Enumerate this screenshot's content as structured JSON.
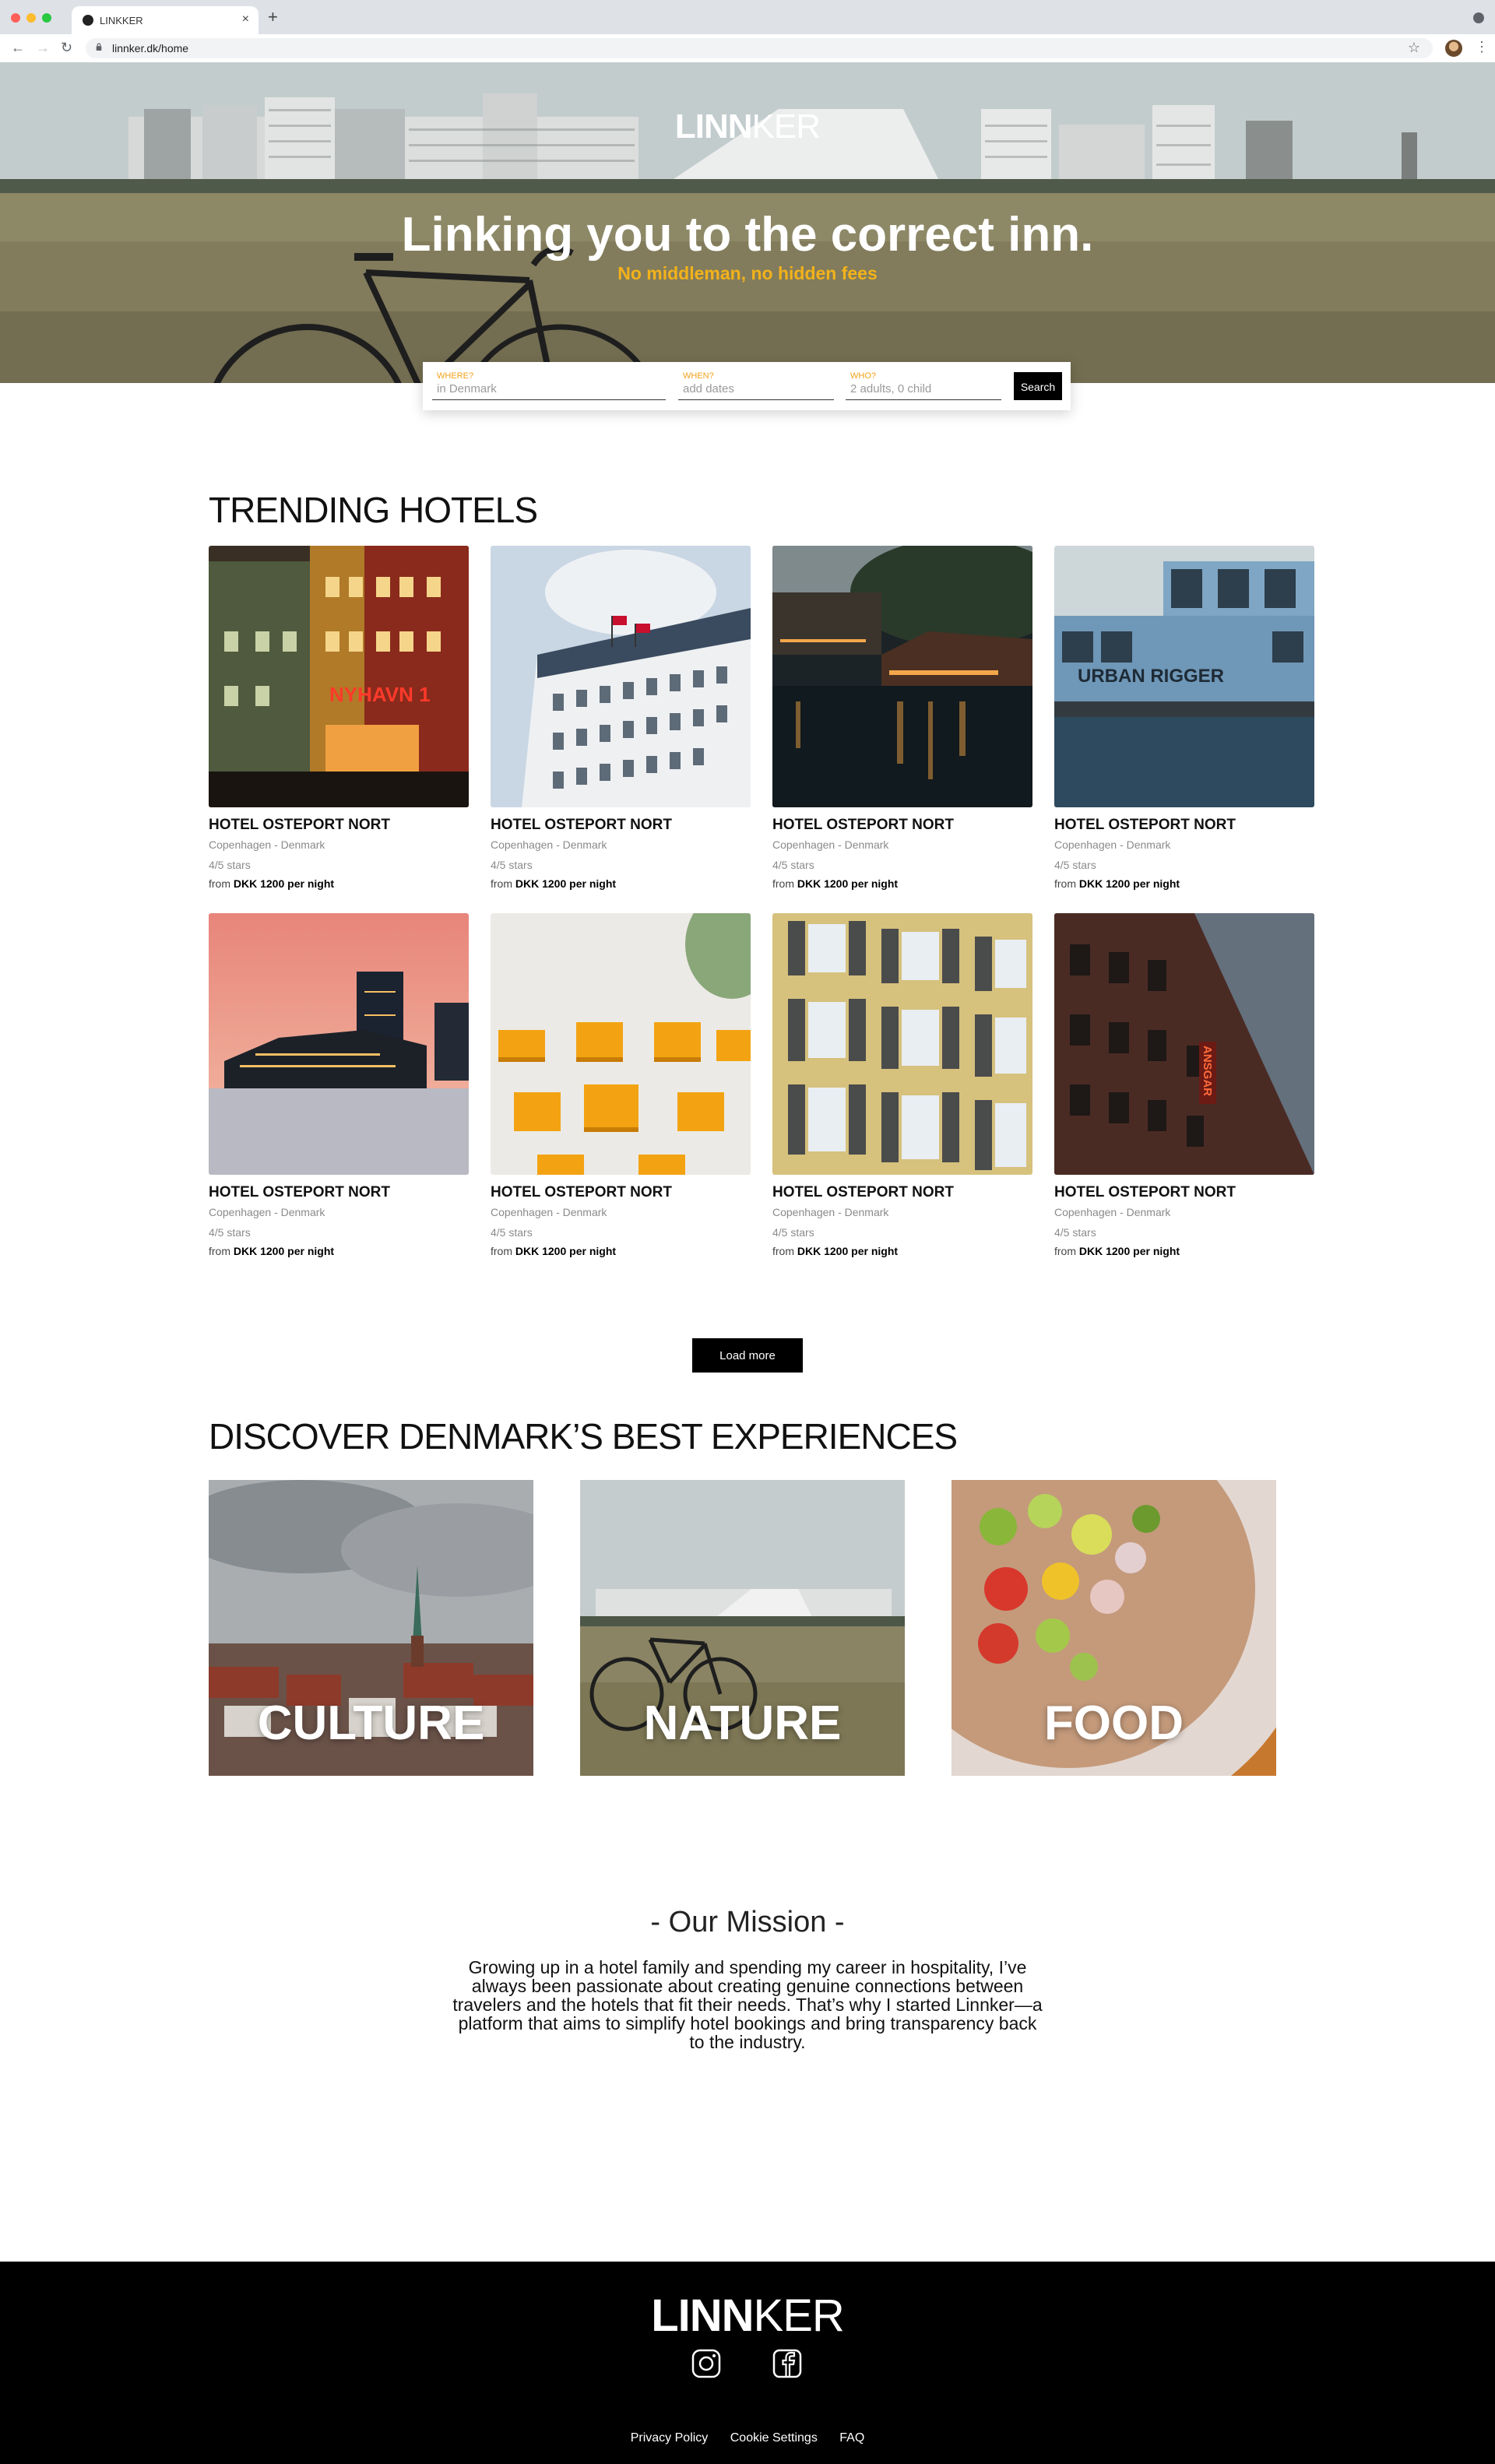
{
  "browser": {
    "tab_title": "LINKKER",
    "url": "linnker.dk/home"
  },
  "brand": {
    "logo_bold": "LINN",
    "logo_rest": "KER",
    "accent": "#f3b21a"
  },
  "hero": {
    "title": "Linking you to the correct inn.",
    "subtitle": "No middleman, no hidden fees"
  },
  "search": {
    "where_label": "WHERE?",
    "where_value": "in Denmark",
    "when_label": "WHEN?",
    "when_value": "add dates",
    "who_label": "WHO?",
    "who_value": "2 adults, 0 child",
    "button": "Search"
  },
  "trending": {
    "title": "TRENDING HOTELS",
    "hotels": [
      {
        "name": "HOTEL OSTEPORT NORT",
        "location": "Copenhagen - Denmark",
        "stars": "4/5 stars",
        "price_prefix": "from",
        "price": "DKK 1200 per night",
        "sign": "NYHAVN 1"
      },
      {
        "name": "HOTEL OSTEPORT NORT",
        "location": "Copenhagen - Denmark",
        "stars": "4/5 stars",
        "price_prefix": "from",
        "price": "DKK 1200 per night"
      },
      {
        "name": "HOTEL OSTEPORT NORT",
        "location": "Copenhagen - Denmark",
        "stars": "4/5 stars",
        "price_prefix": "from",
        "price": "DKK 1200 per night"
      },
      {
        "name": "HOTEL OSTEPORT NORT",
        "location": "Copenhagen - Denmark",
        "stars": "4/5 stars",
        "price_prefix": "from",
        "price": "DKK 1200 per night",
        "sign": "URBAN RIGGER"
      },
      {
        "name": "HOTEL OSTEPORT NORT",
        "location": "Copenhagen - Denmark",
        "stars": "4/5 stars",
        "price_prefix": "from",
        "price": "DKK 1200 per night"
      },
      {
        "name": "HOTEL OSTEPORT NORT",
        "location": "Copenhagen - Denmark",
        "stars": "4/5 stars",
        "price_prefix": "from",
        "price": "DKK 1200 per night"
      },
      {
        "name": "HOTEL OSTEPORT NORT",
        "location": "Copenhagen - Denmark",
        "stars": "4/5 stars",
        "price_prefix": "from",
        "price": "DKK 1200 per night"
      },
      {
        "name": "HOTEL OSTEPORT NORT",
        "location": "Copenhagen - Denmark",
        "stars": "4/5 stars",
        "price_prefix": "from",
        "price": "DKK 1200 per night",
        "sign": "ANSGAR"
      }
    ],
    "load_more": "Load more"
  },
  "experiences": {
    "title": "DISCOVER DENMARK’S BEST EXPERIENCES",
    "items": [
      {
        "label": "CULTURE"
      },
      {
        "label": "NATURE"
      },
      {
        "label": "FOOD"
      }
    ]
  },
  "mission": {
    "title": "- Our Mission -",
    "text": "Growing up in a hotel family and spending my career in hospitality, I’ve always been passionate about creating genuine connections between travelers and the hotels that fit their needs. That’s why I started Linnker—a platform that aims to simplify hotel bookings and bring transparency back to the industry."
  },
  "footer": {
    "links": [
      "Privacy Policy",
      "Cookie Settings",
      "FAQ"
    ]
  }
}
